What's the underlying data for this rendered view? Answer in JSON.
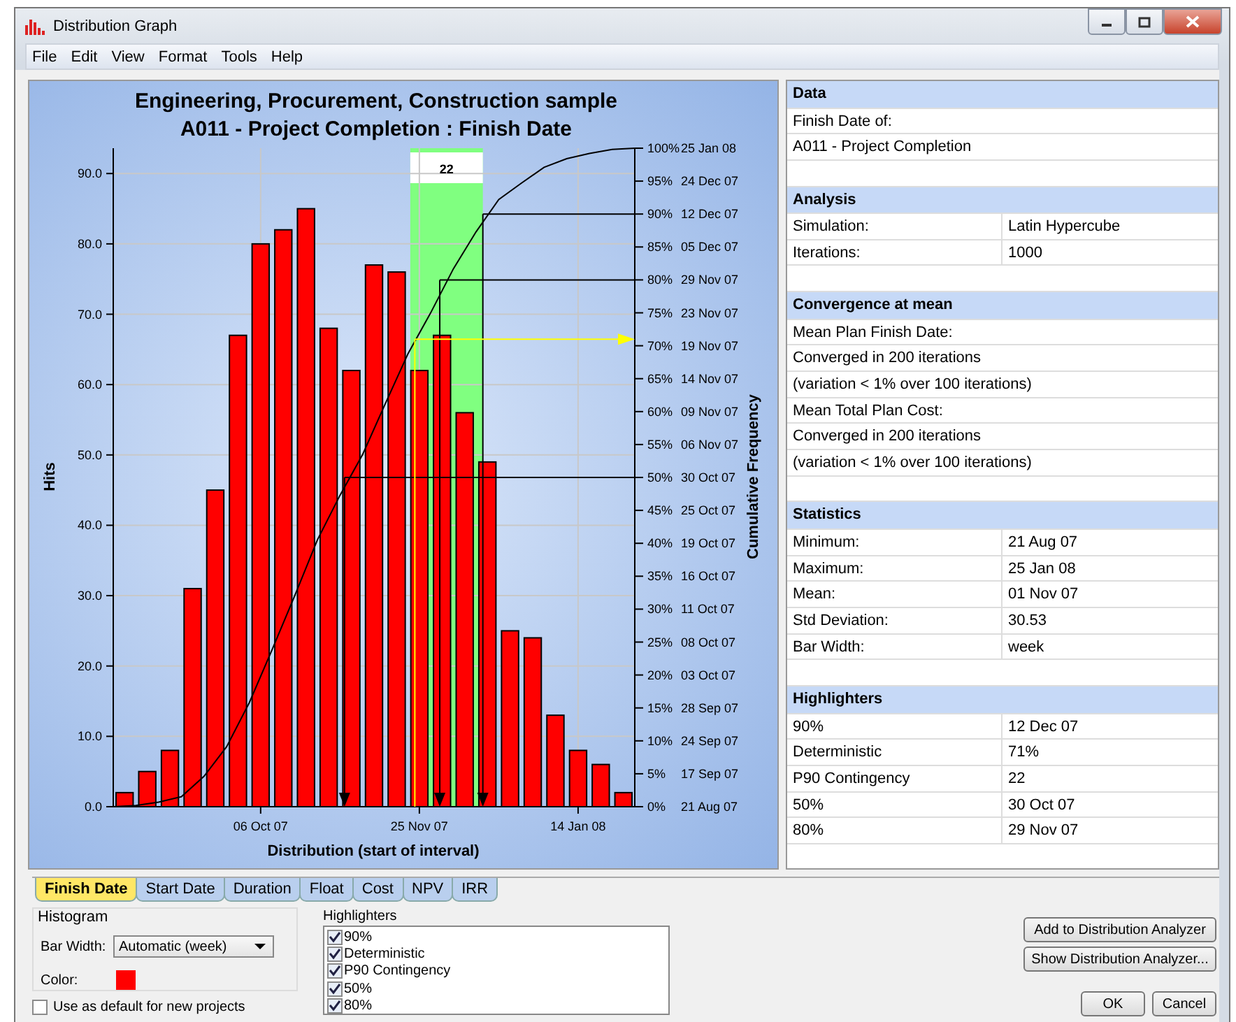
{
  "window": {
    "title": "Distribution Graph"
  },
  "menu": [
    {
      "label": "File"
    },
    {
      "label": "Edit"
    },
    {
      "label": "View"
    },
    {
      "label": "Format"
    },
    {
      "label": "Tools"
    },
    {
      "label": "Help"
    }
  ],
  "chart": {
    "subtitle": "A011 - Project Completion : Finish Date",
    "chart_data": {
      "type": "bar",
      "title": "Engineering, Procurement, Construction sample",
      "xlabel": "Distribution (start of interval)",
      "ylabel": "Hits",
      "categories": [
        null,
        null,
        null,
        null,
        null,
        null,
        "06 Oct 07",
        null,
        null,
        null,
        null,
        null,
        null,
        "25 Nov 07",
        null,
        null,
        null,
        null,
        null,
        null,
        "14 Jan 08",
        null,
        null
      ],
      "values": [
        2,
        5,
        8,
        31,
        45,
        67,
        80,
        82,
        85,
        68,
        62,
        77,
        76,
        62,
        67,
        56,
        49,
        25,
        24,
        13,
        8,
        6,
        2
      ],
      "ylim": [
        0,
        93.6
      ],
      "grid": true,
      "yticks": [
        {
          "value": 0,
          "label": "0.0"
        },
        {
          "value": 10,
          "label": "10.0"
        },
        {
          "value": 20,
          "label": "20.0"
        },
        {
          "value": 30,
          "label": "30.0"
        },
        {
          "value": 40,
          "label": "40.0"
        },
        {
          "value": 50,
          "label": "50.0"
        },
        {
          "value": 60,
          "label": "60.0"
        },
        {
          "value": 70,
          "label": "70.0"
        },
        {
          "value": 80,
          "label": "80.0"
        },
        {
          "value": 90,
          "label": "90.0"
        }
      ]
    },
    "highlight_marks": [
      {
        "kind": "band",
        "label": "22"
      },
      {
        "kind": "level"
      },
      {
        "kind": "level"
      },
      {
        "kind": "level"
      },
      {
        "kind": "deterministic"
      }
    ],
    "cumulative_axis": {
      "label": "Cumulative Frequency",
      "ticks": [
        {
          "percent": "100%",
          "date": "25 Jan 08"
        },
        {
          "percent": "95%",
          "date": "24 Dec 07"
        },
        {
          "percent": "90%",
          "date": "12 Dec 07"
        },
        {
          "percent": "85%",
          "date": "05 Dec 07"
        },
        {
          "percent": "80%",
          "date": "29 Nov 07"
        },
        {
          "percent": "75%",
          "date": "23 Nov 07"
        },
        {
          "percent": "70%",
          "date": "19 Nov 07"
        },
        {
          "percent": "65%",
          "date": "14 Nov 07"
        },
        {
          "percent": "60%",
          "date": "09 Nov 07"
        },
        {
          "percent": "55%",
          "date": "06 Nov 07"
        },
        {
          "percent": "50%",
          "date": "30 Oct 07"
        },
        {
          "percent": "45%",
          "date": "25 Oct 07"
        },
        {
          "percent": "40%",
          "date": "19 Oct 07"
        },
        {
          "percent": "35%",
          "date": "16 Oct 07"
        },
        {
          "percent": "30%",
          "date": "11 Oct 07"
        },
        {
          "percent": "25%",
          "date": "08 Oct 07"
        },
        {
          "percent": "20%",
          "date": "03 Oct 07"
        },
        {
          "percent": "15%",
          "date": "28 Sep 07"
        },
        {
          "percent": "10%",
          "date": "24 Sep 07"
        },
        {
          "percent": "5%",
          "date": "17 Sep 07"
        },
        {
          "percent": "0%",
          "date": "21 Aug 07"
        }
      ]
    }
  },
  "info_panel": [
    {
      "title": "Data",
      "rows": [
        [
          "Finish Date of:"
        ],
        [
          "A011 - Project Completion"
        ]
      ]
    },
    {
      "title": "Analysis",
      "rows": [
        [
          "Simulation:",
          "Latin Hypercube"
        ],
        [
          "Iterations:",
          "1000"
        ]
      ]
    },
    {
      "title": "Convergence at mean",
      "rows": [
        [
          "Mean Plan Finish Date:"
        ],
        [
          "Converged in 200 iterations"
        ],
        [
          "(variation < 1% over 100 iterations)"
        ],
        [
          "Mean Total Plan Cost:"
        ],
        [
          "Converged in 200 iterations"
        ],
        [
          "(variation < 1% over 100 iterations)"
        ]
      ]
    },
    {
      "title": "Statistics",
      "rows": [
        [
          "Minimum:",
          "21 Aug 07"
        ],
        [
          "Maximum:",
          "25 Jan 08"
        ],
        [
          "Mean:",
          "01 Nov 07"
        ],
        [
          "Std Deviation:",
          "30.53"
        ],
        [
          "Bar Width:",
          "week"
        ]
      ]
    },
    {
      "title": "Highlighters",
      "rows": [
        [
          "90%",
          "12 Dec 07"
        ],
        [
          "Deterministic",
          "71%"
        ],
        [
          "P90 Contingency",
          "22"
        ],
        [
          "50%",
          "30 Oct 07"
        ],
        [
          "80%",
          "29 Nov 07"
        ]
      ]
    }
  ],
  "tabs": [
    {
      "label": "Finish Date",
      "selected": true
    },
    {
      "label": "Start Date",
      "selected": false
    },
    {
      "label": "Duration",
      "selected": false
    },
    {
      "label": "Float",
      "selected": false
    },
    {
      "label": "Cost",
      "selected": false
    },
    {
      "label": "NPV",
      "selected": false
    },
    {
      "label": "IRR",
      "selected": false
    }
  ],
  "histogram": {
    "title": "Histogram",
    "bar_width_label": "Bar Width:",
    "bar_width_value": "Automatic (week)",
    "color_label": "Color:",
    "color": "#ff0000"
  },
  "default_checkbox": {
    "label": "Use as default for new projects",
    "checked": false
  },
  "highlighters": {
    "title": "Highlighters",
    "items": [
      {
        "label": "90%",
        "checked": true
      },
      {
        "label": "Deterministic",
        "checked": true
      },
      {
        "label": "P90 Contingency",
        "checked": true
      },
      {
        "label": "50%",
        "checked": true
      },
      {
        "label": "80%",
        "checked": true
      }
    ]
  },
  "buttons": {
    "add": "Add to Distribution Analyzer",
    "show": "Show Distribution Analyzer...",
    "ok": "OK",
    "cancel": "Cancel"
  }
}
